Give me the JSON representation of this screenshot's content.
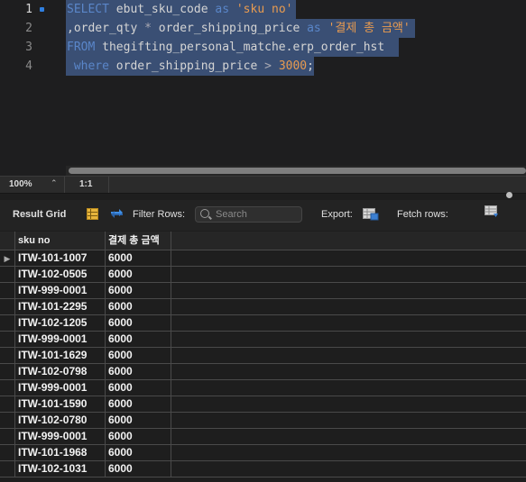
{
  "editor": {
    "line_numbers": [
      "1",
      "2",
      "3",
      "4"
    ],
    "lines": [
      [
        {
          "t": "SELECT",
          "c": "kw"
        },
        {
          "t": " ebut_sku_code ",
          "c": ""
        },
        {
          "t": "as",
          "c": "kw"
        },
        {
          "t": " ",
          "c": ""
        },
        {
          "t": "'sku no'",
          "c": "str"
        }
      ],
      [
        {
          "t": ",order_qty ",
          "c": ""
        },
        {
          "t": "*",
          "c": "op"
        },
        {
          "t": " order_shipping_price ",
          "c": ""
        },
        {
          "t": "as",
          "c": "kw"
        },
        {
          "t": " ",
          "c": ""
        },
        {
          "t": "'결제 총 금액'",
          "c": "str"
        }
      ],
      [
        {
          "t": "FROM",
          "c": "kw"
        },
        {
          "t": " thegifting_personal_matche.erp_order_hst",
          "c": ""
        }
      ],
      [
        {
          "t": " ",
          "c": ""
        },
        {
          "t": "where",
          "c": "kw"
        },
        {
          "t": " order_shipping_price ",
          "c": ""
        },
        {
          "t": ">",
          "c": "op"
        },
        {
          "t": " ",
          "c": ""
        },
        {
          "t": "3000",
          "c": "num"
        },
        {
          "t": ";",
          "c": ""
        }
      ]
    ]
  },
  "status": {
    "zoom": "100%",
    "position": "1:1"
  },
  "toolbar": {
    "result_grid_label": "Result Grid",
    "filter_rows_label": "Filter Rows:",
    "search_placeholder": "Search",
    "export_label": "Export:",
    "fetch_rows_label": "Fetch rows:"
  },
  "grid": {
    "columns": [
      "sku no",
      "결제 총 금액"
    ],
    "rows": [
      [
        "ITW-101-1007",
        "6000"
      ],
      [
        "ITW-102-0505",
        "6000"
      ],
      [
        "ITW-999-0001",
        "6000"
      ],
      [
        "ITW-101-2295",
        "6000"
      ],
      [
        "ITW-102-1205",
        "6000"
      ],
      [
        "ITW-999-0001",
        "6000"
      ],
      [
        "ITW-101-1629",
        "6000"
      ],
      [
        "ITW-102-0798",
        "6000"
      ],
      [
        "ITW-999-0001",
        "6000"
      ],
      [
        "ITW-101-1590",
        "6000"
      ],
      [
        "ITW-102-0780",
        "6000"
      ],
      [
        "ITW-999-0001",
        "6000"
      ],
      [
        "ITW-101-1968",
        "6000"
      ],
      [
        "ITW-102-1031",
        "6000"
      ]
    ],
    "current_row_marker": "▶"
  }
}
